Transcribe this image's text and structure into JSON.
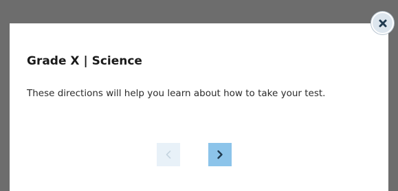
{
  "dialog": {
    "title": "Grade X | Science",
    "body": "These directions will help you learn about how to take your test.",
    "close_icon": "close-icon",
    "prev_icon": "chevron-left-icon",
    "next_icon": "chevron-right-icon",
    "prev_enabled": false,
    "next_enabled": true
  },
  "colors": {
    "overlay": "#6d6d6d",
    "dialog_background": "#ffffff",
    "next_button": "#8cc4ea",
    "prev_button_disabled": "#e8f1f8",
    "close_button": "#dde6ee",
    "icon_dark": "#1f3a4f"
  }
}
